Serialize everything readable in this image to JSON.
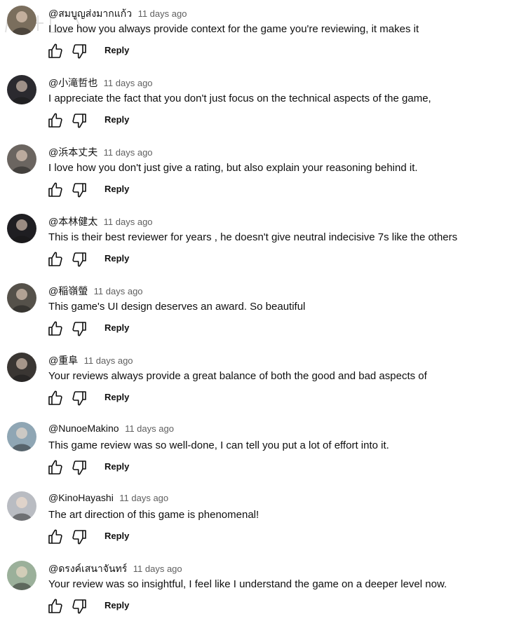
{
  "comments": [
    {
      "author": "@สมบูญส่งมากแก้ว",
      "time": "11 days ago",
      "text": "I love how you always provide context for the game you're reviewing, it makes it",
      "reply_label": "Reply",
      "avatar_bg": "#7a6e5d"
    },
    {
      "author": "@小滝哲也",
      "time": "11 days ago",
      "text": "I appreciate the fact that you don't just focus on the technical aspects of the game,",
      "reply_label": "Reply",
      "avatar_bg": "#2b2a2f"
    },
    {
      "author": "@浜本丈夫",
      "time": "11 days ago",
      "text": "I love how you don't just give a rating, but also explain your reasoning behind it.",
      "reply_label": "Reply",
      "avatar_bg": "#6b6560"
    },
    {
      "author": "@本林健太",
      "time": "11 days ago",
      "text": "This is their best reviewer for years , he doesn't give neutral indecisive 7s like the others",
      "reply_label": "Reply",
      "avatar_bg": "#1f1e22"
    },
    {
      "author": "@稲嶺螢",
      "time": "11 days ago",
      "text": "This game's UI design deserves an award. So beautiful",
      "reply_label": "Reply",
      "avatar_bg": "#55514a"
    },
    {
      "author": "@重阜",
      "time": "11 days ago",
      "text": "Your reviews always provide a great balance of both the good and bad aspects of",
      "reply_label": "Reply",
      "avatar_bg": "#3a3633"
    },
    {
      "author": "@NunoeMakino",
      "time": "11 days ago",
      "text": "This game review was so well-done, I can tell you put a lot of effort into it.",
      "reply_label": "Reply",
      "avatar_bg": "#8fa6b4"
    },
    {
      "author": "@KinoHayashi",
      "time": "11 days ago",
      "text": "The art direction of this game is phenomenal!",
      "reply_label": "Reply",
      "avatar_bg": "#b9bcc2"
    },
    {
      "author": "@ดรงค์เสนาจันทร์",
      "time": "11 days ago",
      "text": "Your review was so insightful, I feel like I understand the game on a deeper level now.",
      "reply_label": "Reply",
      "avatar_bg": "#9bb09a"
    }
  ],
  "icons": {
    "like": "thumb-up-icon",
    "dislike": "thumb-down-icon"
  },
  "colors": {
    "text": "#0f0f0f",
    "meta": "#606060"
  }
}
